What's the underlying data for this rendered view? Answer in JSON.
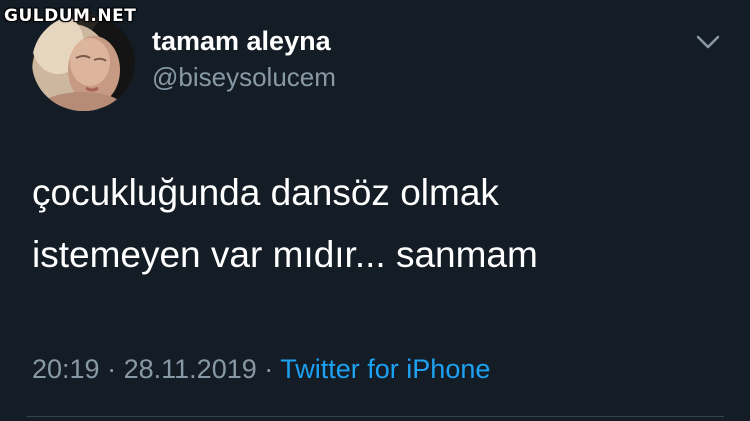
{
  "watermark": "GULDUM.NET",
  "tweet": {
    "display_name": "tamam aleyna",
    "handle": "@biseysolucem",
    "text_lines": [
      "çocukluğunda dansöz olmak",
      "istemeyen var mıdır... sanmam"
    ],
    "time": "20:19",
    "separator": "·",
    "date": "28.11.2019",
    "source": "Twitter for iPhone"
  },
  "icons": {
    "menu": "chevron-down-icon",
    "avatar": "profile-photo"
  },
  "colors": {
    "background": "#141d26",
    "primary_text": "#ffffff",
    "secondary_text": "#8899a6",
    "link": "#1da1f2",
    "divider": "#38444d"
  }
}
